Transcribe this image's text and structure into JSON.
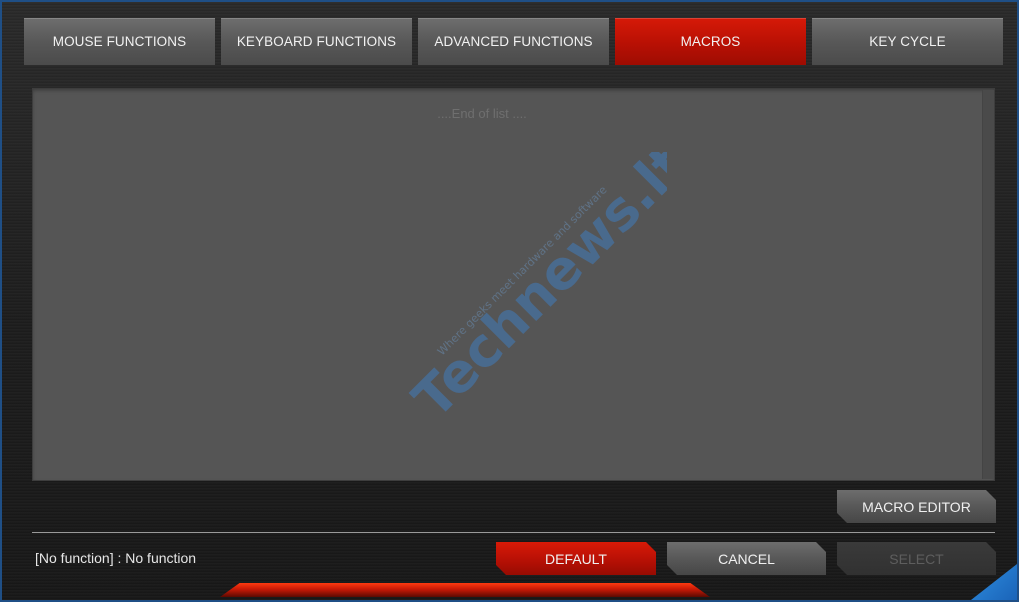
{
  "tabs": [
    {
      "label": "MOUSE FUNCTIONS",
      "active": false
    },
    {
      "label": "KEYBOARD FUNCTIONS",
      "active": false
    },
    {
      "label": "ADVANCED FUNCTIONS",
      "active": false
    },
    {
      "label": "MACROS",
      "active": true
    },
    {
      "label": "KEY CYCLE",
      "active": false
    }
  ],
  "list": {
    "end_text": "....End of list ...."
  },
  "watermark": {
    "brand": "Technews.lt",
    "tagline": "Where geeks meet hardware and software"
  },
  "buttons": {
    "macro_editor": "MACRO EDITOR",
    "default": "DEFAULT",
    "cancel": "CANCEL",
    "select": "SELECT"
  },
  "status": {
    "text": "[No function] : No function"
  },
  "colors": {
    "accent_red": "#c01306",
    "panel_gray": "#555555",
    "frame_blue": "#1f4f86"
  }
}
